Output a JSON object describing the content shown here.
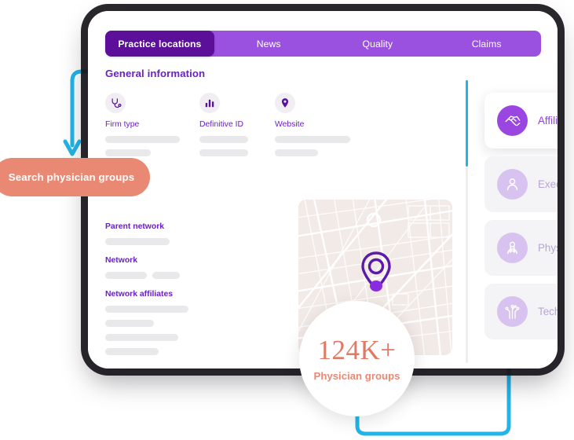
{
  "tabs": [
    {
      "label": "Practice locations",
      "active": true
    },
    {
      "label": "News",
      "active": false
    },
    {
      "label": "Quality",
      "active": false
    },
    {
      "label": "Claims",
      "active": false
    }
  ],
  "left_panel": {
    "section_title": "General information",
    "fields": [
      {
        "label": "Firm type",
        "icon": "stethoscope-icon"
      },
      {
        "label": "Definitive ID",
        "icon": "bar-chart-icon"
      },
      {
        "label": "Website",
        "icon": "map-pin-icon"
      }
    ],
    "groups": [
      {
        "label": "Parent network"
      },
      {
        "label": "Network"
      },
      {
        "label": "Network affiliates"
      }
    ]
  },
  "map": {
    "marker_icon": "map-pin-marker-icon"
  },
  "right_panel": {
    "items": [
      {
        "label": "Affiliations",
        "icon": "handshake-icon",
        "active": true
      },
      {
        "label": "Executives",
        "icon": "person-icon",
        "active": false
      },
      {
        "label": "Physicians",
        "icon": "doctor-icon",
        "active": false
      },
      {
        "label": "Technologies",
        "icon": "circuit-icon",
        "active": false
      }
    ]
  },
  "callout": {
    "label": "Search physician groups"
  },
  "stat": {
    "value": "124K+",
    "label": "Physician groups"
  },
  "colors": {
    "tab_bar": "#9b51e0",
    "tab_active": "#5c0f99",
    "purple_text": "#6b21c4",
    "accent_cyan": "#22b5e8",
    "salmon": "#e98873",
    "stat_value": "#e27a63",
    "skeleton": "#e9e8ea",
    "map_bg": "#f2eae6"
  }
}
